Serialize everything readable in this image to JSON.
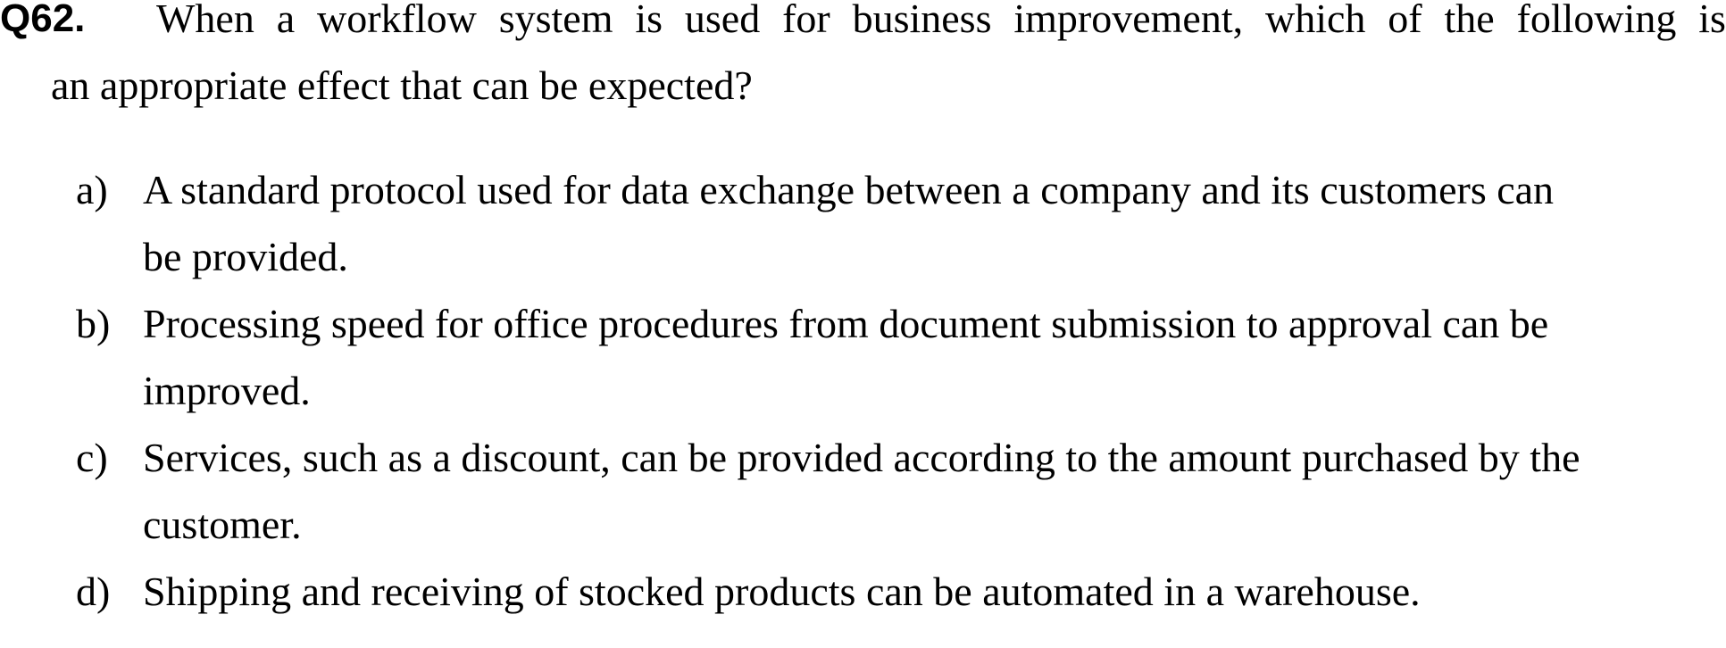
{
  "question": {
    "number": "Q62.",
    "line1": "When a workflow system is used for business improvement, which of the following is",
    "line2": "an appropriate effect that can be expected?"
  },
  "options": [
    {
      "label": "a)",
      "lines": [
        "A standard protocol used for data exchange between a company and its customers can",
        "be provided."
      ]
    },
    {
      "label": "b)",
      "lines": [
        "Processing speed for office procedures from document submission to approval can be",
        "improved."
      ]
    },
    {
      "label": "c)",
      "lines": [
        "Services, such as a discount, can be provided according to the amount purchased by the",
        "customer."
      ]
    },
    {
      "label": "d)",
      "lines": [
        "Shipping and receiving of stocked products can be automated in a warehouse."
      ]
    }
  ]
}
